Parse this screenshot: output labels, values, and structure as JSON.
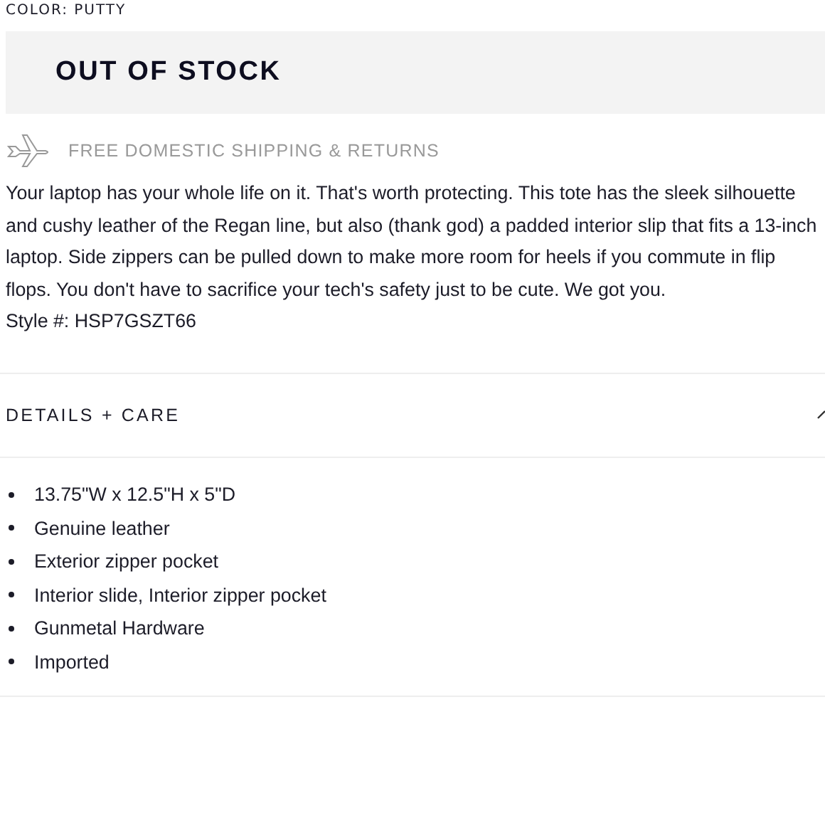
{
  "color_label": "COLOR: PUTTY",
  "stock_button": {
    "label": "OUT OF STOCK",
    "disabled": true
  },
  "shipping": {
    "label": "FREE DOMESTIC SHIPPING & RETURNS"
  },
  "description": "Your laptop has your whole life on it. That's worth protecting. This tote has the sleek silhouette and cushy leather of the Regan line, but also (thank god) a padded interior slip that fits a 13-inch laptop. Side zippers can be pulled down to make more room for heels if you commute in flip flops. You don't have to sacrifice your tech's safety just to be cute. We got you.",
  "style_number": "Style #: HSP7GSZT66",
  "details": {
    "title": "DETAILS + CARE",
    "expanded": true,
    "items": [
      "13.75\"W x 12.5\"H x 5\"D",
      "Genuine leather",
      "Exterior zipper pocket",
      "Interior slide, Interior zipper pocket",
      "Gunmetal Hardware",
      "Imported"
    ]
  }
}
